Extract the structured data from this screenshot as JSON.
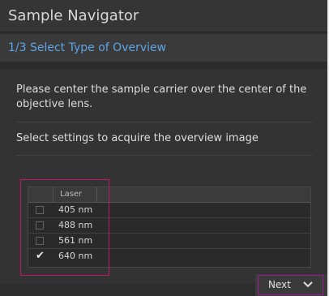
{
  "window": {
    "title": "Sample Navigator"
  },
  "step": {
    "label": "1/3 Select Type of Overview"
  },
  "content": {
    "instruction": "Please center the sample carrier over the center of the objective lens.",
    "prompt": "Select settings to acquire the overview image"
  },
  "laser_table": {
    "header": "Laser",
    "rows": [
      {
        "label": "405 nm",
        "checked": false
      },
      {
        "label": "488 nm",
        "checked": false
      },
      {
        "label": "561 nm",
        "checked": false
      },
      {
        "label": "640 nm",
        "checked": true
      }
    ]
  },
  "footer": {
    "next_label": "Next"
  },
  "icons": {
    "checkmark": "check-icon",
    "next_chevron": "chevron-down-icon"
  },
  "colors": {
    "accent_text": "#5fa5e6",
    "highlight_table": "#c0166e",
    "highlight_button": "#9a1f97",
    "panel_bg": "#2d2d2d"
  }
}
